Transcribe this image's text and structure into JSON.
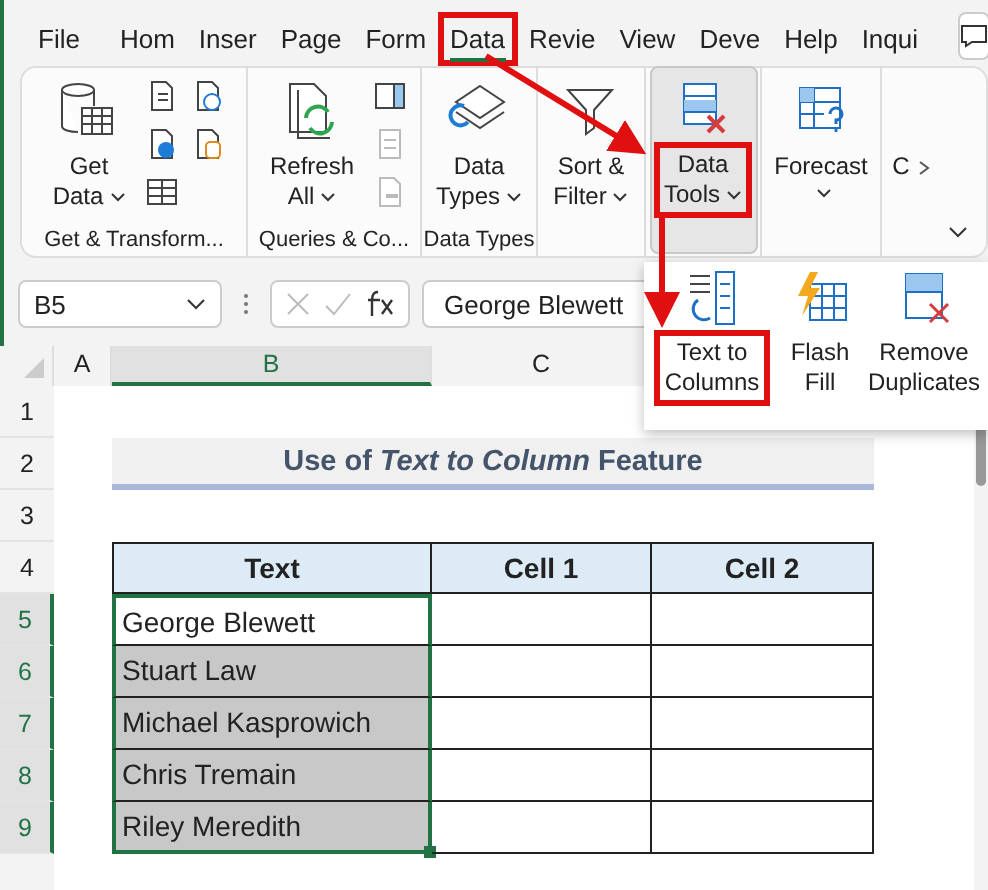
{
  "tabs": [
    {
      "label": "File",
      "selected": false,
      "highlighted": false
    },
    {
      "label": "Hom",
      "selected": false,
      "highlighted": false
    },
    {
      "label": "Inser",
      "selected": false,
      "highlighted": false
    },
    {
      "label": "Page",
      "selected": false,
      "highlighted": false
    },
    {
      "label": "Form",
      "selected": false,
      "highlighted": false
    },
    {
      "label": "Data",
      "selected": true,
      "highlighted": true
    },
    {
      "label": "Revie",
      "selected": false,
      "highlighted": false
    },
    {
      "label": "View",
      "selected": false,
      "highlighted": false
    },
    {
      "label": "Deve",
      "selected": false,
      "highlighted": false
    },
    {
      "label": "Help",
      "selected": false,
      "highlighted": false
    },
    {
      "label": "Inqui",
      "selected": false,
      "highlighted": false
    }
  ],
  "ribbon": {
    "groups": [
      {
        "label": "Get & Transform...",
        "button": {
          "lines": [
            "Get",
            "Data"
          ],
          "dropdown": true,
          "open": false,
          "highlighted": false
        }
      },
      {
        "label": "Queries & Co...",
        "button": {
          "lines": [
            "Refresh",
            "All"
          ],
          "dropdown": true,
          "open": false,
          "highlighted": false
        }
      },
      {
        "label": "Data Types",
        "button": {
          "lines": [
            "Data",
            "Types"
          ],
          "dropdown": true,
          "open": false,
          "highlighted": false
        }
      },
      {
        "button": {
          "lines": [
            "Sort &",
            "Filter"
          ],
          "dropdown": true,
          "open": false,
          "highlighted": false
        }
      },
      {
        "button": {
          "lines": [
            "Data",
            "Tools"
          ],
          "dropdown": true,
          "open": true,
          "highlighted": true
        }
      },
      {
        "button": {
          "lines": [
            "Forecast"
          ],
          "dropdown": true,
          "open": false,
          "highlighted": false
        }
      },
      {
        "button": {
          "lines": [
            "C"
          ],
          "dropdown": false,
          "open": false,
          "highlighted": false
        }
      }
    ]
  },
  "dropdown": {
    "items": [
      {
        "lines": [
          "Text to",
          "Columns"
        ],
        "highlighted": true
      },
      {
        "lines": [
          "Flash",
          "Fill"
        ],
        "highlighted": false
      },
      {
        "lines": [
          "Remove",
          "Duplicates"
        ],
        "highlighted": false
      }
    ]
  },
  "formula_bar": {
    "name_box": "B5",
    "formula": "George Blewett"
  },
  "sheet": {
    "columns": [
      {
        "label": "A",
        "selected": false
      },
      {
        "label": "B",
        "selected": true
      },
      {
        "label": "C",
        "selected": false
      }
    ],
    "rows": [
      {
        "label": "1",
        "selected": false
      },
      {
        "label": "2",
        "selected": false
      },
      {
        "label": "3",
        "selected": false
      },
      {
        "label": "4",
        "selected": false
      },
      {
        "label": "5",
        "selected": true
      },
      {
        "label": "6",
        "selected": true
      },
      {
        "label": "7",
        "selected": true
      },
      {
        "label": "8",
        "selected": true
      },
      {
        "label": "9",
        "selected": true
      }
    ],
    "title": "Use of *Text to Column*  Feature",
    "table": {
      "headers": [
        "Text",
        "Cell 1",
        "Cell 2"
      ],
      "rows": [
        {
          "text": "George Blewett",
          "active": true
        },
        {
          "text": "Stuart Law",
          "active": false
        },
        {
          "text": "Michael Kasprowich",
          "active": false
        },
        {
          "text": "Chris Tremain",
          "active": false
        },
        {
          "text": "Riley Meredith",
          "active": false
        }
      ]
    }
  }
}
